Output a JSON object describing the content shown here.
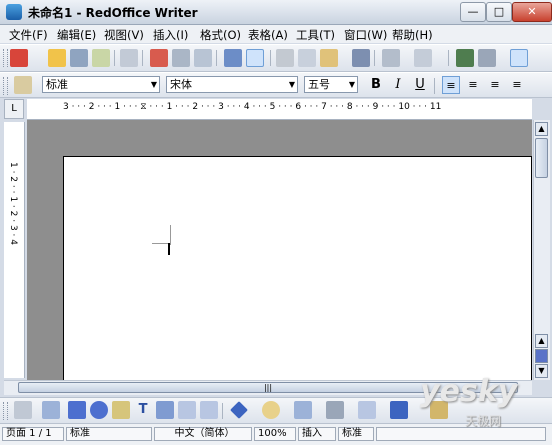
{
  "window": {
    "title": "未命名1 - RedOffice Writer"
  },
  "menu": [
    "文件(F)",
    "编辑(E)",
    "视图(V)",
    "插入(I)",
    "格式(O)",
    "表格(A)",
    "工具(T)",
    "窗口(W)",
    "帮助(H)"
  ],
  "format": {
    "style": "标准",
    "font": "宋体",
    "size": "五号"
  },
  "ruler": {
    "h_labels": "3 · · · 2 · · · 1 · · · ⧖ · · · 1 · · · 2 · · · 3 · · · 4 · · · 5 · · · 6 · · · 7 · · · 8 · · · 9 · · · 10 · · · 11",
    "v_labels": "1 · 2 · · 1 · 2 · 3 · 4"
  },
  "status": {
    "page": "页面 1 / 1",
    "style": "标准",
    "lang": "中文（简体）",
    "zoom": "100%",
    "mode": "插入",
    "selmode": "标准"
  },
  "watermark": {
    "main": "yesky",
    "sub": "天极网"
  }
}
